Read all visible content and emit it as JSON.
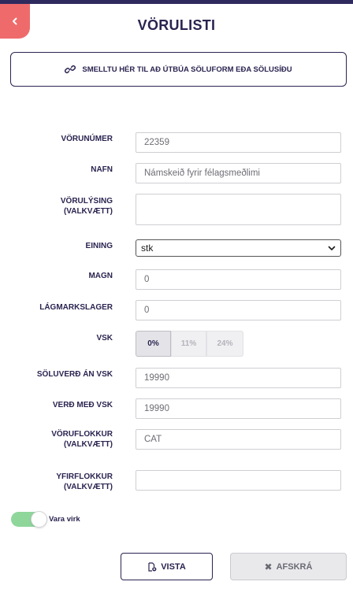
{
  "header": {
    "title": "VÖRULISTI",
    "back_icon": "chevron-left-icon"
  },
  "create_link": {
    "icon": "link-icon",
    "label": "SMELLTU HÉR TIL AÐ ÚTBÚA SÖLUFORM EÐA SÖLUSÍÐU"
  },
  "form": {
    "product_number": {
      "label": "VÖRUNÚMER",
      "value": "22359"
    },
    "name": {
      "label": "NAFN",
      "value": "Námskeið fyrir félagsmeðlimi"
    },
    "description": {
      "label_line1": "VÖRULÝSING",
      "label_line2": "(VALKVÆTT)",
      "value": ""
    },
    "unit": {
      "label": "EINING",
      "value": "stk"
    },
    "quantity": {
      "label": "MAGN",
      "value": "0"
    },
    "min_stock": {
      "label": "LÁGMARKSLAGER",
      "value": "0"
    },
    "vat": {
      "label": "VSK",
      "options": [
        "0%",
        "11%",
        "24%"
      ],
      "selected": "0%"
    },
    "price_ex_vat": {
      "label": "SÖLUVERÐ ÁN VSK",
      "value": "19990"
    },
    "price_inc_vat": {
      "label": "VERÐ MEÐ VSK",
      "value": "19990"
    },
    "category": {
      "label_line1": "VÖRUFLOKKUR",
      "label_line2": "(VALKVÆTT)",
      "value": "CAT"
    },
    "parent_category": {
      "label_line1": "YFIRFLOKKUR",
      "label_line2": "(VALKVÆTT)",
      "value": ""
    }
  },
  "active_toggle": {
    "label": "Vara virk",
    "on": true,
    "color": "#8fd69b"
  },
  "actions": {
    "save_label": "VISTA",
    "save_icon": "save-file-icon",
    "cancel_label": "AFSKRÁ",
    "cancel_icon": "close-icon"
  },
  "colors": {
    "primary": "#2a2450",
    "back_button": "#ef6b6b",
    "top_strip": "#2f2a5e"
  }
}
